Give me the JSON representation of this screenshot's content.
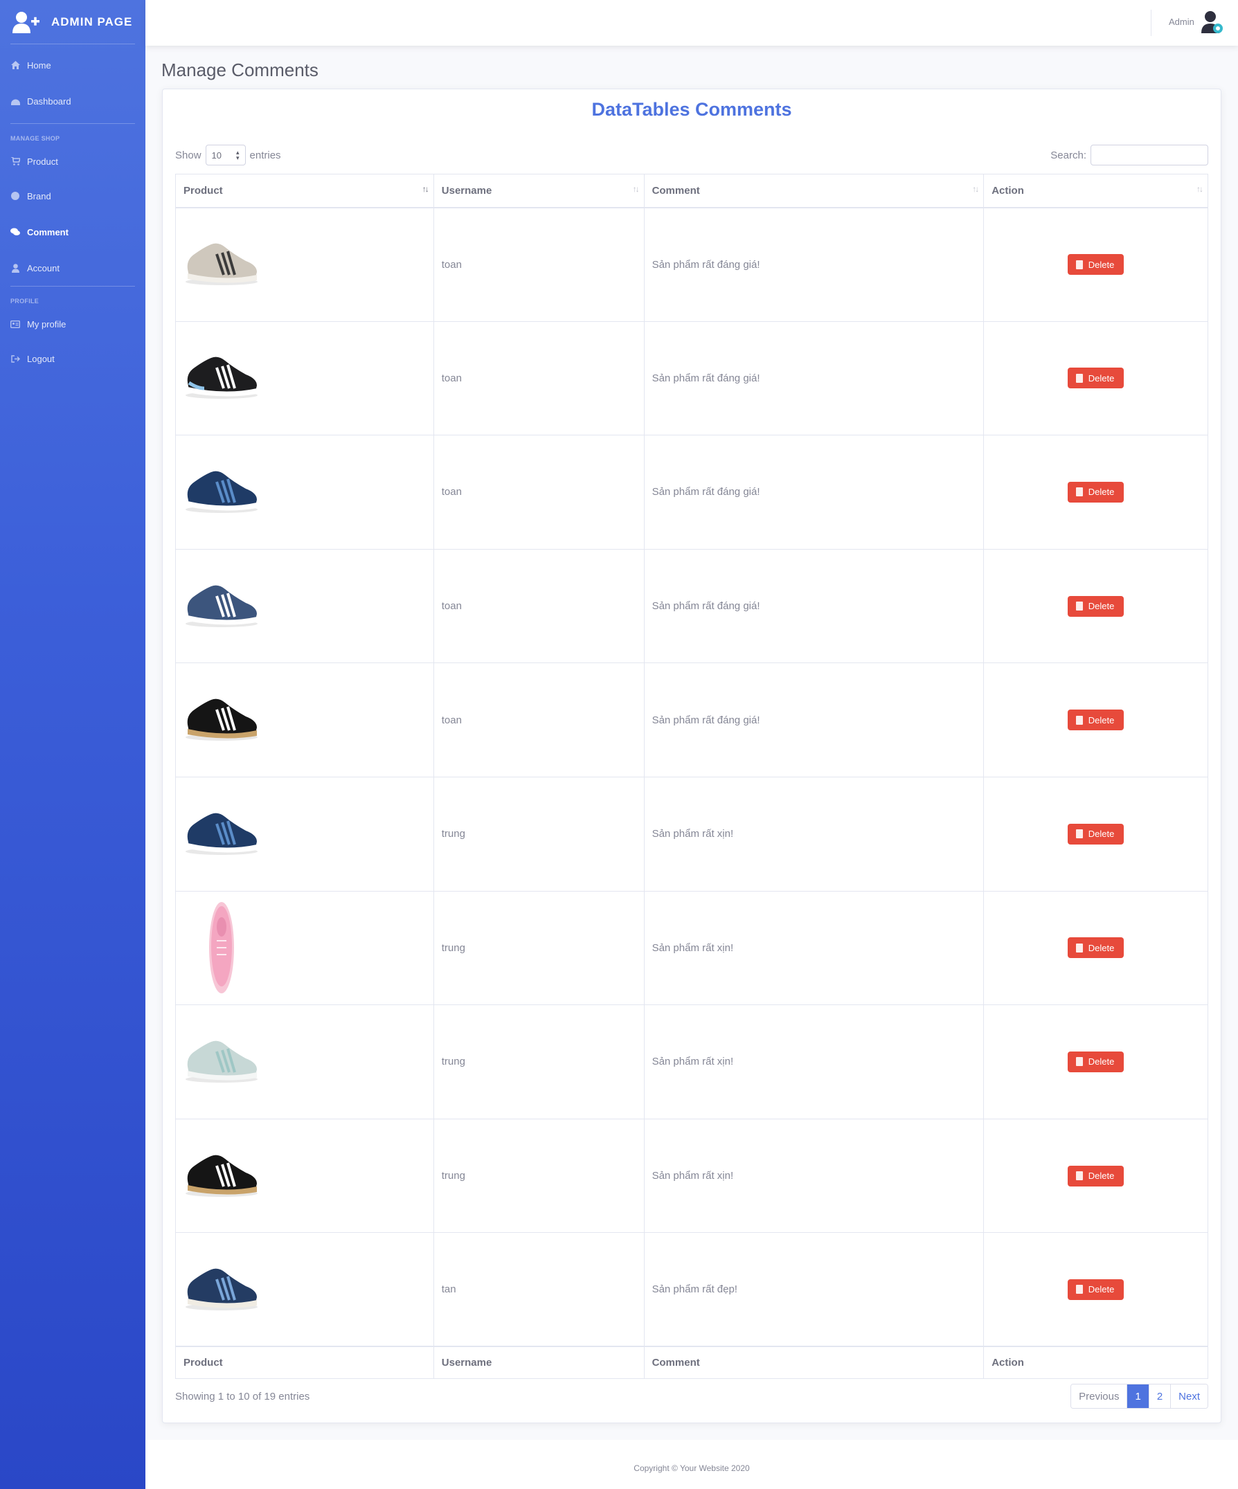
{
  "sidebar": {
    "brand": "ADMIN PAGE",
    "items_top": [
      {
        "label": "Home",
        "icon": "home-icon"
      },
      {
        "label": "Dashboard",
        "icon": "dashboard-icon"
      }
    ],
    "heading_shop": "MANAGE SHOP",
    "items_shop": [
      {
        "label": "Product",
        "icon": "cart-icon"
      },
      {
        "label": "Brand",
        "icon": "circle-icon"
      },
      {
        "label": "Comment",
        "icon": "comments-icon"
      },
      {
        "label": "Account",
        "icon": "user-icon"
      }
    ],
    "heading_profile": "PROFILE",
    "items_profile": [
      {
        "label": "My profile",
        "icon": "id-card-icon"
      },
      {
        "label": "Logout",
        "icon": "logout-icon"
      }
    ]
  },
  "topbar": {
    "user": "Admin"
  },
  "page": {
    "title": "Manage Comments"
  },
  "card": {
    "title": "DataTables Comments",
    "show_label": "Show",
    "entries_label": "entries",
    "length_value": "10",
    "search_label": "Search:",
    "search_value": "",
    "delete_label": "Delete"
  },
  "table": {
    "columns": [
      "Product",
      "Username",
      "Comment",
      "Action"
    ],
    "rows": [
      {
        "product_image": "grey-sneaker",
        "username": "toan",
        "comment": "Sản phẩm rất đáng giá!"
      },
      {
        "product_image": "black-running-shoe",
        "username": "toan",
        "comment": "Sản phẩm rất đáng giá!"
      },
      {
        "product_image": "blue-knit-shoe",
        "username": "toan",
        "comment": "Sản phẩm rất đáng giá!"
      },
      {
        "product_image": "navy-stripe-shoe",
        "username": "toan",
        "comment": "Sản phẩm rất đáng giá!"
      },
      {
        "product_image": "black-gum-sneaker",
        "username": "toan",
        "comment": "Sản phẩm rất đáng giá!"
      },
      {
        "product_image": "blue-knit-shoe",
        "username": "trung",
        "comment": "Sản phẩm rất xịn!"
      },
      {
        "product_image": "pink-shoe",
        "username": "trung",
        "comment": "Sản phẩm rất xịn!"
      },
      {
        "product_image": "mint-running-shoe",
        "username": "trung",
        "comment": "Sản phẩm rất xịn!"
      },
      {
        "product_image": "black-gum-sneaker",
        "username": "trung",
        "comment": "Sản phẩm rất xịn!"
      },
      {
        "product_image": "navy-retro-sneaker",
        "username": "tan",
        "comment": "Sản phẩm rất đẹp!"
      }
    ]
  },
  "info": "Showing 1 to 10 of 19 entries",
  "pagination": {
    "previous": "Previous",
    "pages": [
      "1",
      "2"
    ],
    "current": "1",
    "next": "Next"
  },
  "footer": {
    "copyright": "Copyright © Your Website 2020"
  },
  "colors": {
    "primary": "#4e73df",
    "danger": "#e74a3b",
    "text": "#858796"
  }
}
